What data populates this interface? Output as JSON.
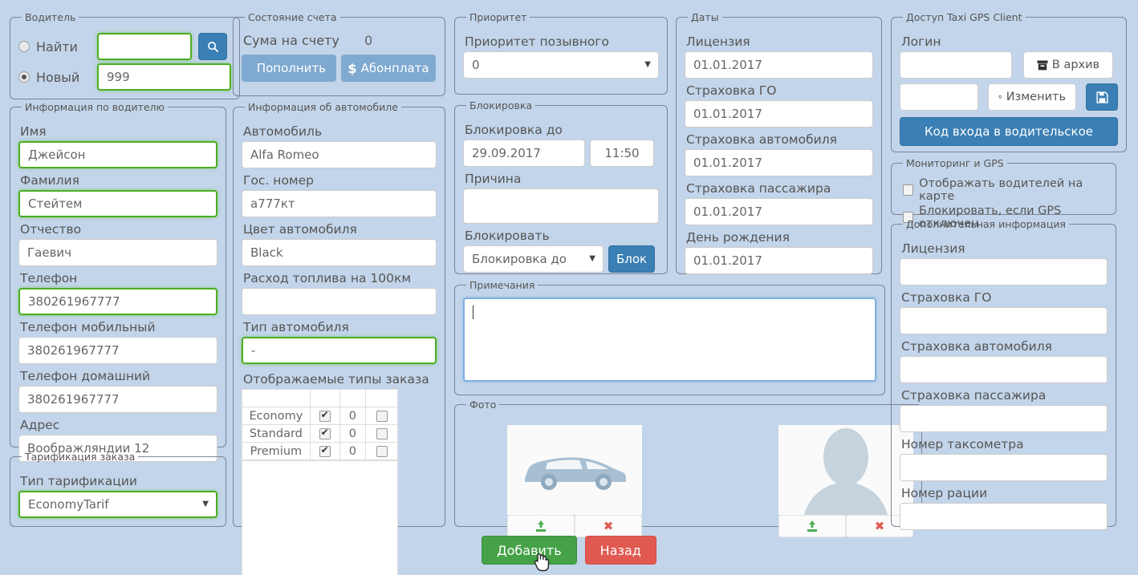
{
  "colors": {
    "background": "#c3d5ea",
    "accent_blue": "#3a7fb5",
    "light_blue": "#7fa9d0",
    "valid_green": "#4cae21",
    "add_green": "#45a247",
    "back_red": "#e05a52"
  },
  "driver": {
    "legend": "Водитель",
    "find_label": "Найти",
    "find_selected": false,
    "find_value": "",
    "new_label": "Новый",
    "new_selected": true,
    "new_value": "999",
    "search_icon": "search-icon"
  },
  "driver_info": {
    "legend": "Информация по водителю",
    "fields": [
      {
        "label": "Имя",
        "value": "Джейсон",
        "valid": true
      },
      {
        "label": "Фамилия",
        "value": "Стейтем",
        "valid": true
      },
      {
        "label": "Отчество",
        "value": "Гаевич",
        "valid": false
      },
      {
        "label": "Телефон",
        "value": "380261967777",
        "valid": true
      },
      {
        "label": "Телефон мобильный",
        "value": "380261967777",
        "valid": false
      },
      {
        "label": "Телефон домашний",
        "value": "380261967777",
        "valid": false
      },
      {
        "label": "Адрес",
        "value": "Воображляндии 12",
        "valid": false
      }
    ]
  },
  "tarif": {
    "legend": "Тарификация заказа",
    "label": "Тип тарификации",
    "value": "EconomyTarif"
  },
  "account": {
    "legend": "Состояние счета",
    "sum_label": "Сума на счету",
    "sum_value": "0",
    "topup_label": "Пополнить",
    "topup_icon": "credit-card-icon",
    "subscription_label": "Абонплата",
    "subscription_icon": "dollar-icon"
  },
  "car": {
    "legend": "Информация об автомобиле",
    "fields": [
      {
        "label": "Автомобиль",
        "value": "Alfa Romeo",
        "valid": false
      },
      {
        "label": "Гос. номер",
        "value": "а777кт",
        "valid": false
      },
      {
        "label": "Цвет автомобиля",
        "value": "Black",
        "valid": false
      },
      {
        "label": "Расход топлива на 100км",
        "value": "",
        "valid": false
      },
      {
        "label": "Тип автомобиля",
        "value": "-",
        "valid": true
      }
    ],
    "order_types_label": "Отображаемые типы заказа",
    "order_types_rows": [
      {
        "name": "Economy",
        "enabled": true,
        "count": "0",
        "extra": false
      },
      {
        "name": "Standard",
        "enabled": true,
        "count": "0",
        "extra": false
      },
      {
        "name": "Premium",
        "enabled": true,
        "count": "0",
        "extra": false
      }
    ]
  },
  "priority": {
    "legend": "Приоритет",
    "label": "Приоритет позывного",
    "value": "0"
  },
  "block": {
    "legend": "Блокировка",
    "until_label": "Блокировка до",
    "date_value": "29.09.2017",
    "time_value": "11:50",
    "reason_label": "Причина",
    "reason_value": "",
    "mode_label": "Блокировать",
    "mode_value": "Блокировка до",
    "button_label": "Блок"
  },
  "notes": {
    "legend": "Примечания",
    "value": ""
  },
  "photo": {
    "legend": "Фото",
    "car_placeholder_icon": "car-silhouette-icon",
    "person_placeholder_icon": "person-silhouette-icon",
    "upload_icon": "upload-icon",
    "delete_icon": "close-x-icon"
  },
  "dates": {
    "legend": "Даты",
    "fields": [
      {
        "label": "Лицензия",
        "value": "01.01.2017"
      },
      {
        "label": "Страховка ГО",
        "value": "01.01.2017"
      },
      {
        "label": "Страховка автомобиля",
        "value": "01.01.2017"
      },
      {
        "label": "Страховка пассажира",
        "value": "01.01.2017"
      },
      {
        "label": "День рождения",
        "value": "01.01.2017"
      }
    ]
  },
  "gps_client": {
    "legend": "Доступ Taxi GPS Client",
    "login_label": "Логин",
    "login_value": "",
    "archive_label": "В архив",
    "archive_icon": "archive-box-icon",
    "password_value": "",
    "change_label": "Изменить",
    "change_icon": "undo-icon",
    "save_icon": "floppy-save-icon",
    "driver_code_label": "Код входа в водительское"
  },
  "monitoring": {
    "legend": "Мониторинг и GPS",
    "show_on_map_label": "Отображать водителей на карте",
    "show_on_map_checked": false,
    "block_if_gps_off_label": "Блокировать, если GPS отключен",
    "block_if_gps_off_checked": false
  },
  "extra": {
    "legend": "Дополнительная информация",
    "fields": [
      {
        "label": "Лицензия",
        "value": ""
      },
      {
        "label": "Страховка ГО",
        "value": ""
      },
      {
        "label": "Страховка автомобиля",
        "value": ""
      },
      {
        "label": "Страховка пассажира",
        "value": ""
      },
      {
        "label": "Номер таксометра",
        "value": ""
      },
      {
        "label": "Номер рации",
        "value": ""
      }
    ]
  },
  "footer": {
    "add_label": "Добавить",
    "back_label": "Назад"
  }
}
